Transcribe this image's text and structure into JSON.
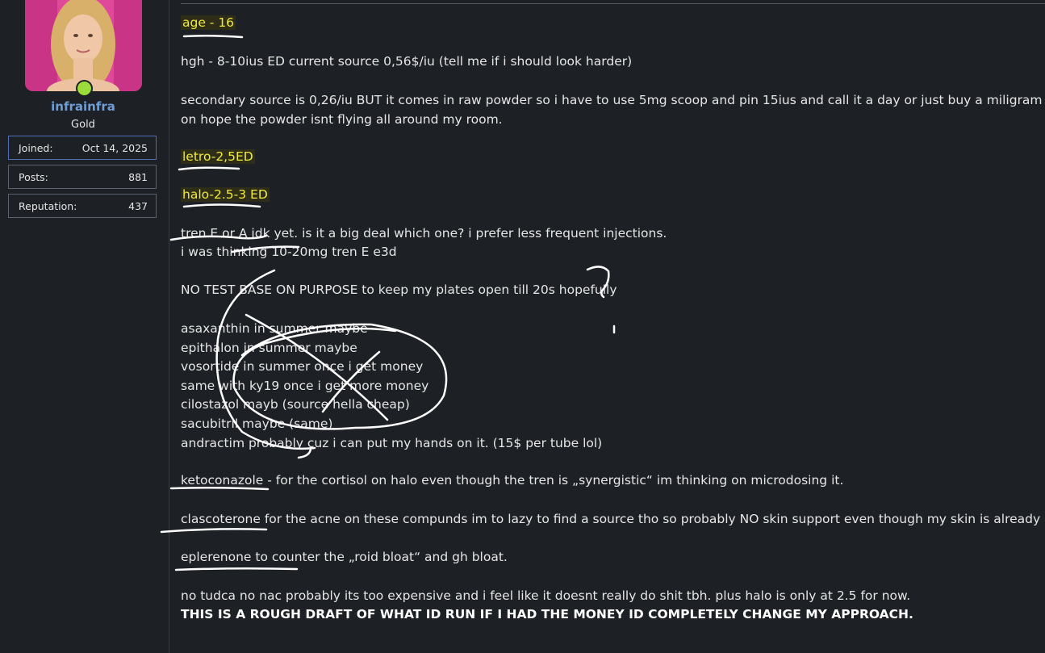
{
  "user": {
    "username": "infrainfra",
    "rank": "Gold",
    "stats": [
      {
        "label": "Joined:",
        "value": "Oct 14, 2025"
      },
      {
        "label": "Posts:",
        "value": "881"
      },
      {
        "label": "Reputation:",
        "value": "437"
      }
    ]
  },
  "post": {
    "age": "age - 16",
    "hgh": "hgh - 8-10ius ED current source 0,56$/iu (tell me if i should look harder)",
    "secondary_1": "secondary source is 0,26/iu BUT it comes in raw powder so i have to use 5mg scoop and pin 15ius and call it a day or just buy a miligram scale",
    "secondary_2": "on hope the powder isnt flying all around my room.",
    "letro": "letro-2,5ED",
    "halo": "halo-2.5-3 ED",
    "tren_1": "tren E or A idk yet. is it a big deal which one? i prefer less frequent injections.",
    "tren_2": "i was thinking 10-20mg tren E e3d",
    "no_test": "NO TEST BASE ON PURPOSE to keep my plates open till 20s hopefully",
    "list": [
      "asaxanthin in summer maybe",
      "epithalon in summer maybe",
      "vosortide in summer once i get money",
      "same with ky19 once i get more money",
      "cilostazol mayb (source hella cheap)",
      "sacubitril maybe (same)",
      "andractim probably cuz i can put my hands on it. (15$ per tube lol)"
    ],
    "keto": "ketoconazole - for the cortisol on halo even though the tren is „synergistic“ im thinking on microdosing it.",
    "clasco": "clascoterone for the acne on these compunds im to lazy to find a source tho so probably NO skin support even though my skin is already nasty.",
    "eple": "eplerenone to counter the „roid bloat“ and gh bloat.",
    "no_tudca": "no tudca no nac probably its too expensive and i feel like it doesnt really do shit tbh. plus halo is only at 2.5 for now.",
    "rough_draft": "THIS IS A ROUGH DRAFT OF WHAT ID RUN IF I HAD THE MONEY ID COMPLETELY CHANGE MY APPROACH."
  },
  "colors": {
    "background": "#1d2024",
    "username": "#6f9ed6",
    "highlight_text": "#f1ea3e",
    "online": "#9bdc3b"
  },
  "icons": [
    "online-status-icon"
  ]
}
